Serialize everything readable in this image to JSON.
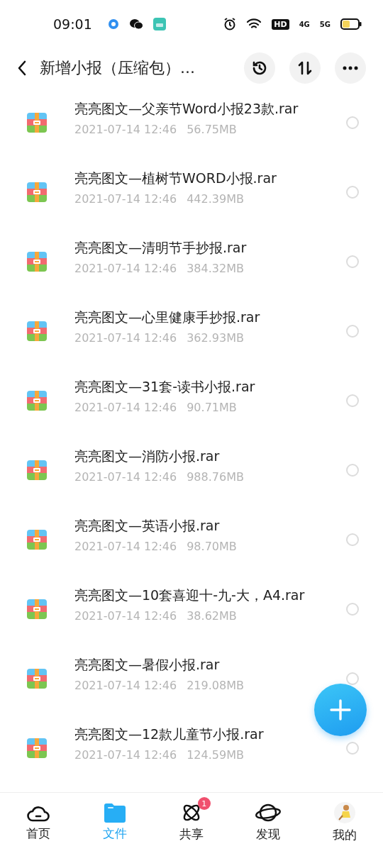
{
  "status_bar": {
    "time": "09:01",
    "hd": "HD",
    "net_4g": "4G",
    "net_5g": "5G"
  },
  "header": {
    "title": "新增小报（压缩包）...",
    "actions": [
      {
        "kind": "history"
      },
      {
        "kind": "sort"
      },
      {
        "kind": "more"
      }
    ]
  },
  "files": [
    {
      "name": "亮亮图文—父亲节Word小报23款.rar",
      "date": "2021-07-14  12:46",
      "size": "56.75MB",
      "selected": false
    },
    {
      "name": "亮亮图文—植树节WORD小报.rar",
      "date": "2021-07-14  12:46",
      "size": "442.39MB",
      "selected": false
    },
    {
      "name": "亮亮图文—清明节手抄报.rar",
      "date": "2021-07-14  12:46",
      "size": "384.32MB",
      "selected": false
    },
    {
      "name": "亮亮图文—心里健康手抄报.rar",
      "date": "2021-07-14  12:46",
      "size": "362.93MB",
      "selected": false
    },
    {
      "name": "亮亮图文—31套-读书小报.rar",
      "date": "2021-07-14  12:46",
      "size": "90.71MB",
      "selected": false
    },
    {
      "name": "亮亮图文—消防小报.rar",
      "date": "2021-07-14  12:46",
      "size": "988.76MB",
      "selected": false
    },
    {
      "name": "亮亮图文—英语小报.rar",
      "date": "2021-07-14  12:46",
      "size": "98.70MB",
      "selected": false
    },
    {
      "name": "亮亮图文—10套喜迎十-九-大，A4.rar",
      "date": "2021-07-14  12:46",
      "size": "38.62MB",
      "selected": false
    },
    {
      "name": "亮亮图文—暑假小报.rar",
      "date": "2021-07-14  12:46",
      "size": "219.08MB",
      "selected": false
    },
    {
      "name": "亮亮图文—12款儿童节小报.rar",
      "date": "2021-07-14  12:46",
      "size": "124.59MB",
      "selected": false
    }
  ],
  "nav": [
    {
      "kind": "home",
      "label": "首页",
      "selected": false
    },
    {
      "kind": "files",
      "label": "文件",
      "selected": true
    },
    {
      "kind": "share",
      "label": "共享",
      "selected": false,
      "badge": "1"
    },
    {
      "kind": "discover",
      "label": "发现",
      "selected": false
    },
    {
      "kind": "me",
      "label": "我的",
      "selected": false
    }
  ]
}
